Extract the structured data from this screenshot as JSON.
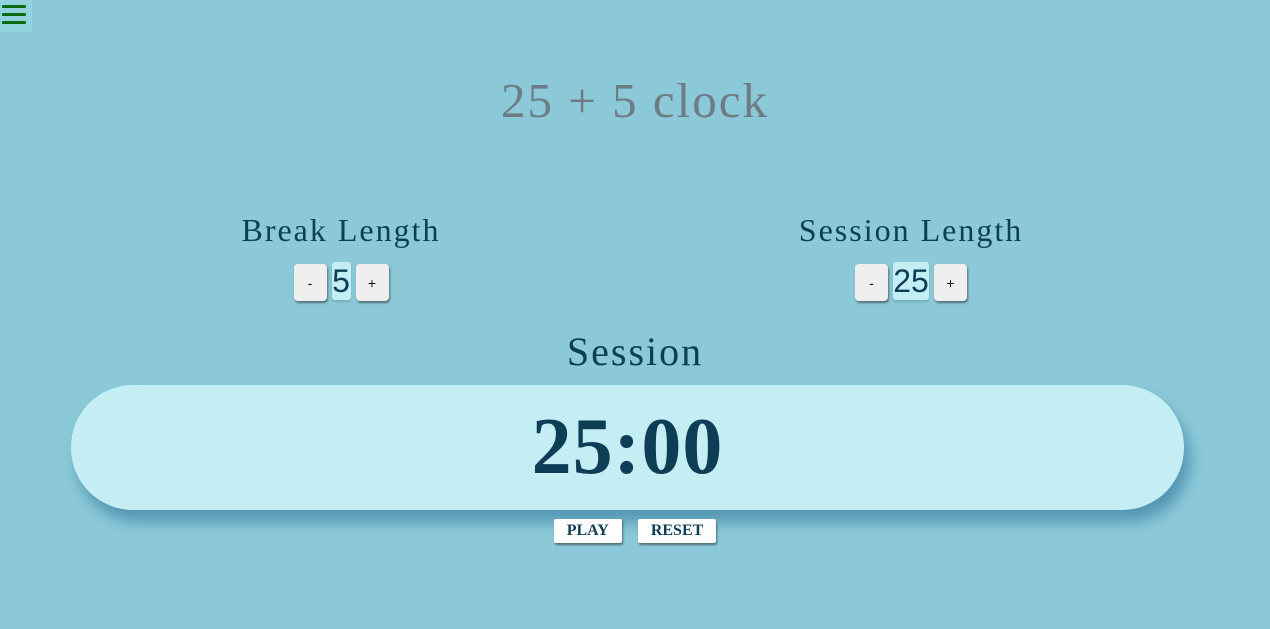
{
  "menu": {
    "icon": "hamburger-menu-icon",
    "color": "#0a6a10"
  },
  "title": "25 + 5 clock",
  "break": {
    "label": "Break Length",
    "decrement": "-",
    "value": "5",
    "increment": "+"
  },
  "session": {
    "label": "Session Length",
    "decrement": "-",
    "value": "25",
    "increment": "+"
  },
  "timer": {
    "label": "Session",
    "time": "25:00"
  },
  "actions": {
    "play": "PLAY",
    "reset": "RESET"
  },
  "colors": {
    "background": "#8bc9d8",
    "panel": "#c5eef4",
    "text": "#0d3e56",
    "title": "#6d7b83"
  }
}
